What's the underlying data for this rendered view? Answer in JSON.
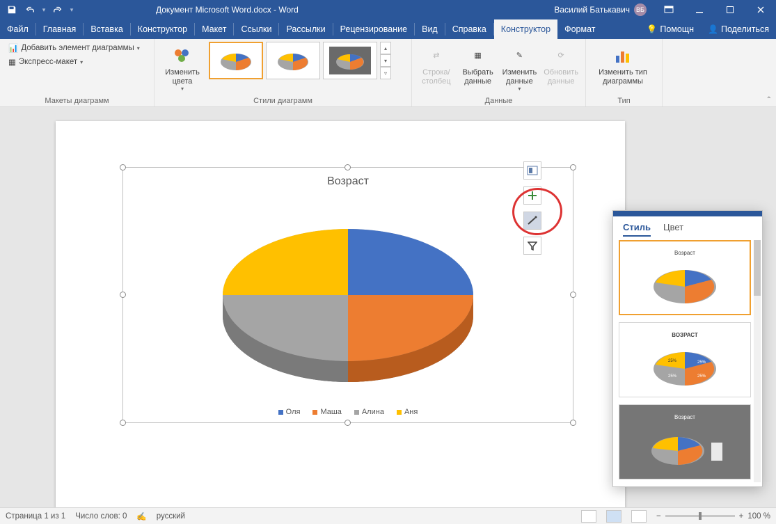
{
  "titlebar": {
    "doc_title": "Документ Microsoft Word.docx  -  Word",
    "user_name": "Василий Батькавич",
    "user_initials": "ВБ"
  },
  "tabs": {
    "file": "Файл",
    "items": [
      "Главная",
      "Вставка",
      "Конструктор",
      "Макет",
      "Ссылки",
      "Рассылки",
      "Рецензирование",
      "Вид",
      "Справка"
    ],
    "ctx_design": "Конструктор",
    "ctx_format": "Формат",
    "help": "Помощн",
    "share": "Поделиться"
  },
  "ribbon": {
    "layouts": {
      "add_element": "Добавить элемент диаграммы",
      "quick_layout": "Экспресс-макет",
      "group": "Макеты диаграмм"
    },
    "styles": {
      "change_colors": "Изменить\nцвета",
      "group": "Стили диаграмм"
    },
    "data": {
      "switch": "Строка/\nстолбец",
      "select": "Выбрать\nданные",
      "edit": "Изменить\nданные",
      "refresh": "Обновить\nданные",
      "group": "Данные"
    },
    "type": {
      "change": "Изменить тип\nдиаграммы",
      "group": "Тип"
    }
  },
  "chart_data": {
    "type": "pie",
    "title": "Возраст",
    "categories": [
      "Оля",
      "Маша",
      "Алина",
      "Аня"
    ],
    "values": [
      25,
      25,
      25,
      25
    ],
    "colors": [
      "#4472c4",
      "#ed7d31",
      "#a5a5a5",
      "#ffc000"
    ]
  },
  "flyout": {
    "tab_style": "Стиль",
    "tab_color": "Цвет",
    "thumb_titles": [
      "Возраст",
      "ВОЗРАСТ",
      "Возраст"
    ]
  },
  "status": {
    "page": "Страница 1 из 1",
    "words": "Число слов: 0",
    "lang": "русский",
    "zoom": "100 %"
  }
}
